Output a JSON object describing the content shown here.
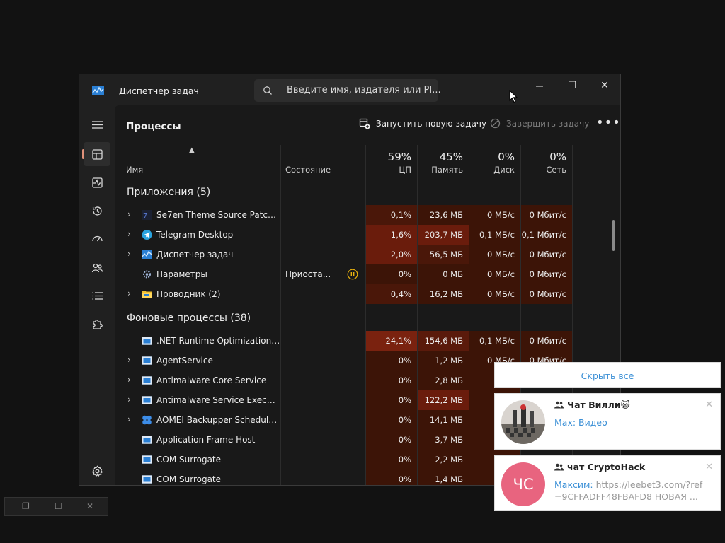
{
  "window": {
    "title": "Диспетчер задач",
    "search_placeholder": "Введите имя, издателя или PI...",
    "controls": {
      "minimize": "—",
      "maximize": "☐",
      "close": "✕"
    }
  },
  "header": {
    "title": "Процессы",
    "run_new_task": "Запустить новую задачу",
    "end_task": "Завершить задачу",
    "more": "•••"
  },
  "columns": {
    "name": "Имя",
    "status": "Состояние",
    "cpu": {
      "percent": "59%",
      "label": "ЦП"
    },
    "memory": {
      "percent": "45%",
      "label": "Память"
    },
    "disk": {
      "percent": "0%",
      "label": "Диск"
    },
    "network": {
      "percent": "0%",
      "label": "Сеть"
    }
  },
  "groups": {
    "apps": "Приложения (5)",
    "background": "Фоновые процессы (38)"
  },
  "apps": [
    {
      "name": "Se7en Theme Source Patcher (...",
      "status": "",
      "cpu": "0,1%",
      "mem": "23,6 МБ",
      "disk": "0 МБ/с",
      "net": "0 Мбит/с",
      "expand": "›"
    },
    {
      "name": "Telegram Desktop",
      "status": "",
      "cpu": "1,6%",
      "mem": "203,7 МБ",
      "disk": "0,1 МБ/с",
      "net": "0,1 Мбит/с",
      "expand": "›"
    },
    {
      "name": "Диспетчер задач",
      "status": "",
      "cpu": "2,0%",
      "mem": "56,5 МБ",
      "disk": "0 МБ/с",
      "net": "0 Мбит/с",
      "expand": "›"
    },
    {
      "name": "Параметры",
      "status": "Приоста...",
      "cpu": "0%",
      "mem": "0 МБ",
      "disk": "0 МБ/с",
      "net": "0 Мбит/с",
      "expand": ""
    },
    {
      "name": "Проводник (2)",
      "status": "",
      "cpu": "0,4%",
      "mem": "16,2 МБ",
      "disk": "0 МБ/с",
      "net": "0 Мбит/с",
      "expand": "›"
    }
  ],
  "background": [
    {
      "name": ".NET Runtime Optimization Se...",
      "cpu": "24,1%",
      "mem": "154,6 МБ",
      "disk": "0,1 МБ/с",
      "net": "0 Мбит/с",
      "expand": ""
    },
    {
      "name": "AgentService",
      "cpu": "0%",
      "mem": "1,2 МБ",
      "disk": "0 МБ/с",
      "net": "0 Мбит/с",
      "expand": "›"
    },
    {
      "name": "Antimalware Core Service",
      "cpu": "0%",
      "mem": "2,8 МБ",
      "disk": "0",
      "net": "",
      "expand": "›"
    },
    {
      "name": "Antimalware Service Executable",
      "cpu": "0%",
      "mem": "122,2 МБ",
      "disk": "0",
      "net": "",
      "expand": "›"
    },
    {
      "name": "AOMEI Backupper Schedule ta...",
      "cpu": "0%",
      "mem": "14,1 МБ",
      "disk": "0",
      "net": "",
      "expand": "›"
    },
    {
      "name": "Application Frame Host",
      "cpu": "0%",
      "mem": "3,7 МБ",
      "disk": "0",
      "net": "",
      "expand": ""
    },
    {
      "name": "COM Surrogate",
      "cpu": "0%",
      "mem": "2,2 МБ",
      "disk": "0",
      "net": "",
      "expand": ""
    },
    {
      "name": "COM Surrogate",
      "cpu": "0%",
      "mem": "1,4 МБ",
      "disk": "0",
      "net": "",
      "expand": ""
    }
  ],
  "notifications": {
    "hide_all": "Скрыть все",
    "items": [
      {
        "title": "Чат Вилли😺",
        "sender": "Max:",
        "text": " Видео",
        "avatar_text": ""
      },
      {
        "title": "чат CryptoHack",
        "sender": "Максим:",
        "text": " https://leebet3.com/?ref=9CFFADFF48FBAFD8 НОВАЯ ...",
        "avatar_text": "ЧС"
      }
    ],
    "close": "✕"
  },
  "mini_window": {
    "restore": "❐",
    "maximize": "☐",
    "close": "✕"
  },
  "colors": {
    "accent": "#e0917a",
    "heat_high": "#6b1a0e",
    "heat_mid": "#4e1609",
    "heat_low": "#3a1408",
    "link": "#3a8fd6"
  }
}
